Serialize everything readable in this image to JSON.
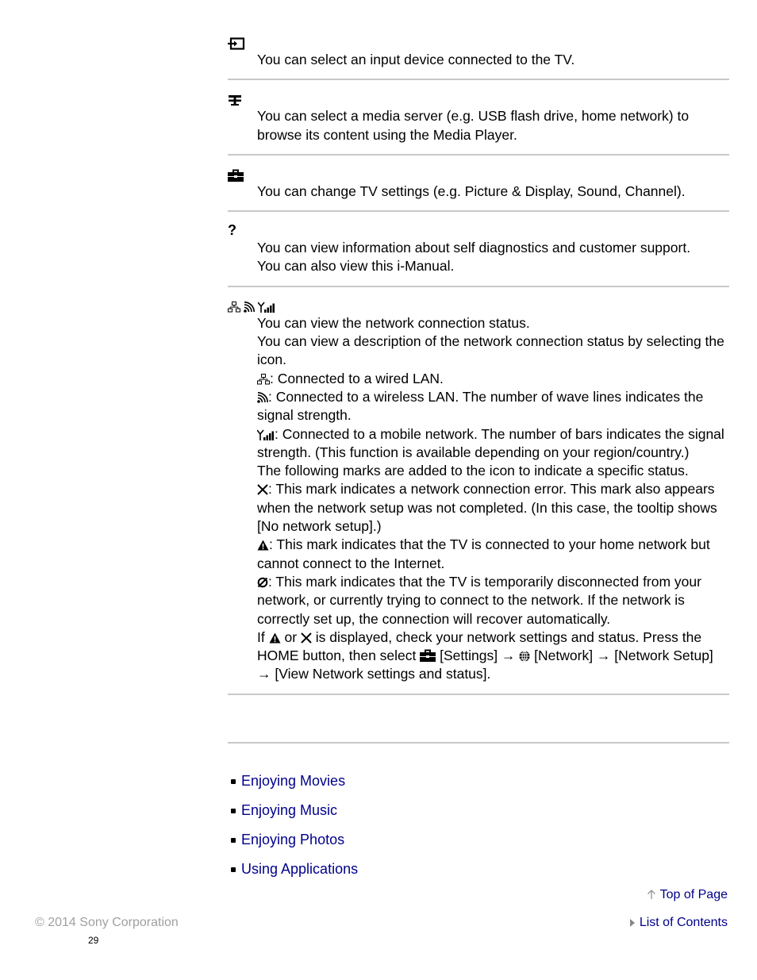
{
  "sections": [
    {
      "icon": "input-icon",
      "lines": [
        "You can select an input device connected to the TV."
      ]
    },
    {
      "icon": "media-server-icon",
      "lines": [
        "You can select a media server (e.g. USB flash drive, home network) to browse its content using the Media Player."
      ]
    },
    {
      "icon": "toolbox-settings-icon",
      "lines": [
        "You can change TV settings (e.g. Picture & Display, Sound, Channel)."
      ]
    },
    {
      "icon": "help-question-icon",
      "lines": [
        "You can view information about self diagnostics and customer support.",
        "You can also view this i-Manual."
      ]
    }
  ],
  "network": {
    "intro1": "You can view the network connection status.",
    "intro2": "You can view a description of the network connection status by selecting the icon.",
    "wired": ": Connected to a wired LAN.",
    "wireless": ": Connected to a wireless LAN. The number of wave lines indicates the signal strength.",
    "mobile": ": Connected to a mobile network. The number of bars indicates the signal strength. (This function is available depending on your region/country.)",
    "marks_intro": "The following marks are added to the icon to indicate a specific status.",
    "error_mark": ": This mark indicates a network connection error. This mark also appears when the network setup was not completed. (In this case, the tooltip shows [No network setup].)",
    "warning_mark": ": This mark indicates that the TV is connected to your home network but cannot connect to the Internet.",
    "disconnected_mark": ": This mark indicates that the TV is temporarily disconnected from your network, or currently trying to connect to the network. If the network is correctly set up, the connection will recover automatically.",
    "final_if": "If ",
    "final_or": " or ",
    "final_rest": " is displayed, check your network settings and status. Press the HOME button, then select ",
    "final_settings": " [Settings] → ",
    "final_network": " [Network] → [Network Setup] → [View Network settings and status]."
  },
  "related_links": [
    "Enjoying Movies",
    "Enjoying Music",
    "Enjoying Photos",
    "Using Applications"
  ],
  "footer": {
    "top_of_page": "Top of Page",
    "list_of_contents": "List of Contents",
    "copyright": "© 2014 Sony Corporation",
    "page_number": "29"
  },
  "colors": {
    "link": "#00008b",
    "separator": "#c8c8c8",
    "copyright": "#a0a0a0"
  }
}
